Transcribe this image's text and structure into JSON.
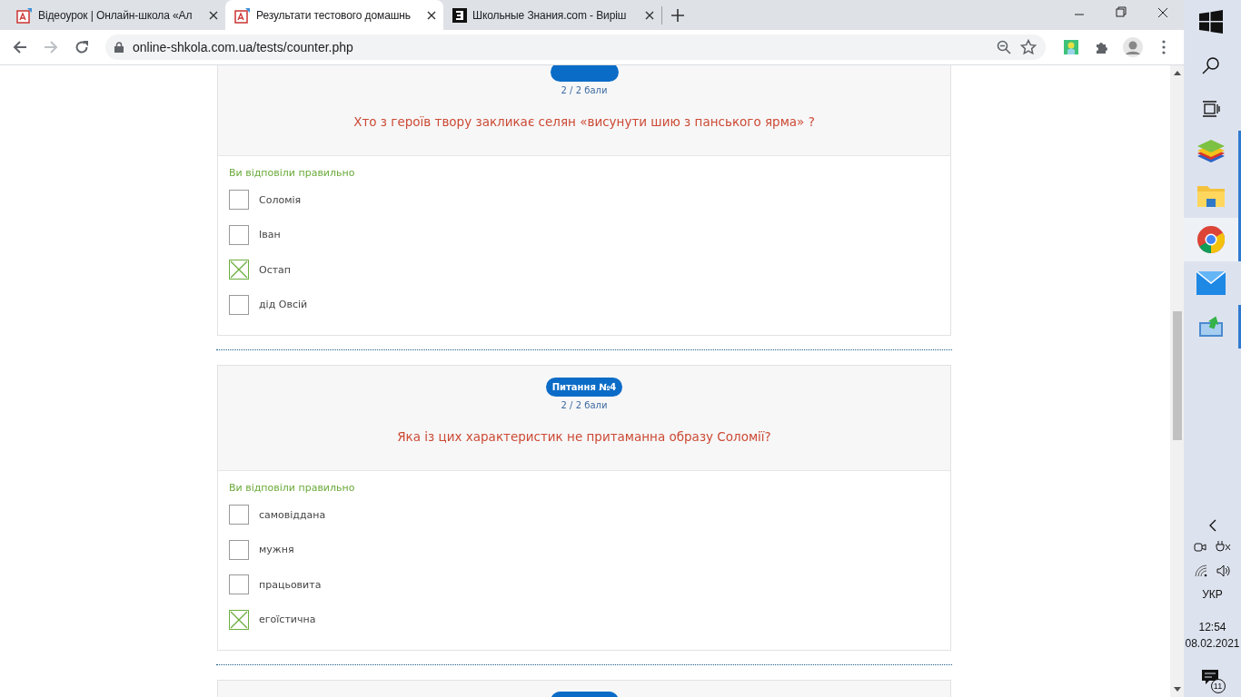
{
  "browser": {
    "tabs": [
      {
        "title": "Відеоурок | Онлайн-школа «Ал",
        "selected": false
      },
      {
        "title": "Результати тестового домашнь",
        "selected": true
      },
      {
        "title": "Школьные Знания.com - Виріш",
        "selected": false
      }
    ],
    "address": "online-shkola.com.ua/tests/counter.php"
  },
  "questions": [
    {
      "score": "2 / 2 бали",
      "question": "Хто з героїв твору закликає селян «висунути шию з панського ярма» ?",
      "status": "Ви відповіли правильно",
      "correct": true,
      "answers": [
        {
          "text": "Соломія",
          "checked": false
        },
        {
          "text": "Іван",
          "checked": false
        },
        {
          "text": "Остап",
          "checked": true
        },
        {
          "text": "дід Овсій",
          "checked": false
        }
      ]
    },
    {
      "badge": "Питання №4",
      "score": "2 / 2 бали",
      "question": "Яка із цих характеристик не притаманна образу Соломії?",
      "status": "Ви відповіли правильно",
      "correct": true,
      "answers": [
        {
          "text": "самовіддана",
          "checked": false
        },
        {
          "text": "мужня",
          "checked": false
        },
        {
          "text": "працьовита",
          "checked": false
        },
        {
          "text": "егоїстична",
          "checked": true
        }
      ]
    }
  ],
  "taskbar": {
    "language": "УКР",
    "time": "12:54",
    "date": "08.02.2021",
    "notifications": "11"
  }
}
